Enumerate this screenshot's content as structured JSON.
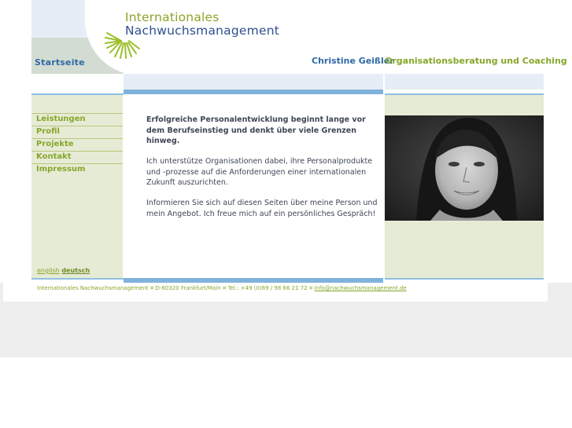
{
  "header": {
    "logo_line1": "Internationales",
    "logo_line2": "Nachwuchsmanagement",
    "home_link": "Startseite",
    "person_name": "Christine Geißler",
    "tagline": "Organisationsberatung und Coaching"
  },
  "nav": {
    "items": [
      {
        "label": "Leistungen"
      },
      {
        "label": "Profil"
      },
      {
        "label": "Projekte"
      },
      {
        "label": "Kontakt"
      },
      {
        "label": "Impressum"
      }
    ]
  },
  "language": {
    "english": "english",
    "deutsch": "deutsch"
  },
  "main": {
    "lead": "Erfolgreiche Personalentwicklung beginnt lange vor dem Berufseinstieg und denkt über viele Grenzen hinweg.",
    "paragraph1": "Ich unterstütze Organisationen dabei, ihre Personalprodukte und -prozesse auf die Anforderungen einer internationalen Zukunft auszurichten.",
    "paragraph2": "Informieren Sie sich auf diesen Seiten über meine Person und mein Angebot. Ich freue mich auf ein persönliches Gespräch!"
  },
  "footer": {
    "address": "Internationales Nachwuchsmanagement ¤ D-60320 Frankfurt/Main ¤ Tel.: +49 (0)69 / 98 66 21 72 ¤ ",
    "email": "info@nachwuchsmanagement.de"
  },
  "colors": {
    "accent_green": "#86a72a",
    "accent_blue": "#2f6aa6",
    "bar_blue": "#7fb3dc",
    "panel_green": "#e6ebd5"
  }
}
